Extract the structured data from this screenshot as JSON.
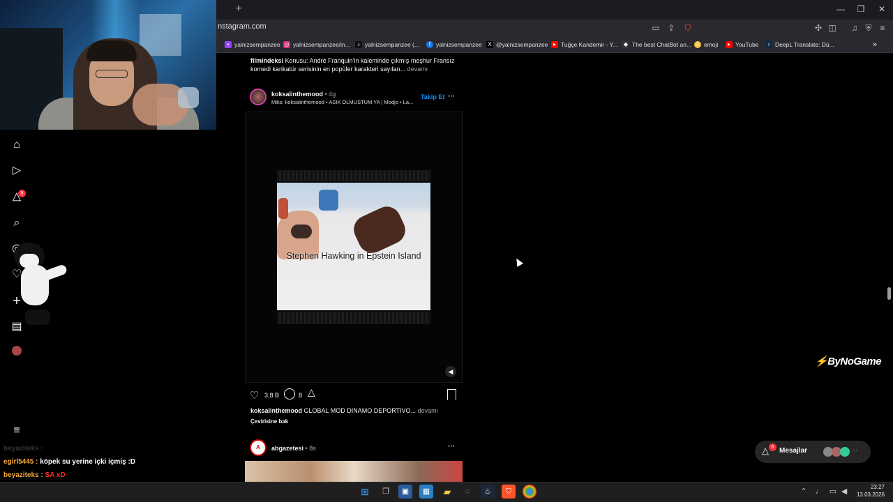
{
  "browser": {
    "new_tab": "+",
    "url": "nstagram.com",
    "window_controls": {
      "minimize": "—",
      "restore": "❐",
      "close": "✕"
    },
    "bookmarks": [
      {
        "label": "yalnizsempanzee",
        "icon": "twitch-icon"
      },
      {
        "label": "yalnizsempanzee/in...",
        "icon": "instagram-icon"
      },
      {
        "label": "yalnizsempanzee (...",
        "icon": "tiktok-icon"
      },
      {
        "label": "yalnizsempanzee",
        "icon": "facebook-icon"
      },
      {
        "label": "@yalnizsempanzee",
        "icon": "x-icon"
      },
      {
        "label": "Tuğçe Kandemir - Y...",
        "icon": "youtube-icon"
      },
      {
        "label": "The best ChatBot an...",
        "icon": "chatbot-icon"
      },
      {
        "label": "emoji",
        "icon": "emoji-icon"
      },
      {
        "label": "YouTube",
        "icon": "youtube-icon"
      },
      {
        "label": "DeepL Translate: Dü...",
        "icon": "deepl-icon"
      }
    ],
    "more": "»"
  },
  "nav": {
    "notification_count": "8"
  },
  "chat": [
    {
      "user": "beyaziteks :",
      "msg": ""
    },
    {
      "user": "egirl5445 :",
      "msg": "köpek su yerine içki içmiş :D"
    },
    {
      "user": "beyaziteks :",
      "msg": "SA  xD"
    }
  ],
  "feed": {
    "prev_post": {
      "username": "filmindeksi",
      "caption_line1": "Konusu: André Franquin'in kaleminde çıkmış meşhur Fransız",
      "caption_line2": "komedi karikatür serisinin en popüler karakteri sayılan...",
      "more": "devamı"
    },
    "post": {
      "username": "koksalinthemood",
      "time": "• 4g",
      "audio": "Miks: koksalinthemood • ASIK OLMUSTUM YA | Modjo • La...",
      "follow": "Takip Et",
      "menu": "···",
      "video_caption": "Stephen Hawking in Epstein Island",
      "likes": "3,8 B",
      "comments": "8",
      "caption_user": "koksalinthemood",
      "caption_text": "GLOBAL MOD DINAMO DEPORTIVO...",
      "caption_more": "devamı",
      "translate": "Çevirisine bak"
    },
    "next_post": {
      "username": "abgazetesi",
      "time": "• 8s",
      "menu": "···"
    }
  },
  "watermark": "ByNoGame",
  "messages": {
    "label": "Mesajlar",
    "badge": "6"
  },
  "taskbar": {
    "time": "23:27",
    "date": "13.03.2026"
  },
  "colors": {
    "link_blue": "#0095f6",
    "badge_red": "#ff3040",
    "chat_orange": "#f2a93b",
    "chat_red": "#ff2b2b",
    "chat_blue": "#3b5bff"
  }
}
